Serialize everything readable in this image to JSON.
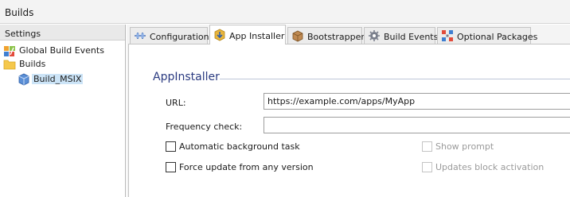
{
  "header": {
    "title": "Builds"
  },
  "settings_panel": {
    "title": "Settings",
    "items": [
      {
        "label": "Global Build Events",
        "icon": "global-build-events-icon"
      },
      {
        "label": "Builds",
        "icon": "folder-icon"
      },
      {
        "label": "Build_MSIX",
        "icon": "package-icon",
        "selected": true
      }
    ]
  },
  "tabs": [
    {
      "label": "Configuration",
      "icon": "configuration-icon"
    },
    {
      "label": "App Installer",
      "icon": "app-installer-icon",
      "active": true
    },
    {
      "label": "Bootstrapper",
      "icon": "bootstrapper-box-icon"
    },
    {
      "label": "Build Events",
      "icon": "build-events-gear-icon"
    },
    {
      "label": "Optional Packages",
      "icon": "optional-packages-icon"
    }
  ],
  "app_installer": {
    "group_title": "AppInstaller",
    "url_label": "URL:",
    "url_value": "https://example.com/apps/MyApp",
    "frequency_label": "Frequency check:",
    "frequency_value": "",
    "automatic_background_task": {
      "label": "Automatic background task",
      "checked": false
    },
    "force_update": {
      "label": "Force update from any version",
      "checked": false
    },
    "show_prompt": {
      "label": "Show prompt",
      "checked": false,
      "enabled": false
    },
    "updates_block_activation": {
      "label": "Updates block activation",
      "checked": false,
      "enabled": false
    }
  },
  "colors": {
    "accent_title": "#2a3a80",
    "selection": "#cce4f7",
    "folder": "#f5c84c"
  }
}
